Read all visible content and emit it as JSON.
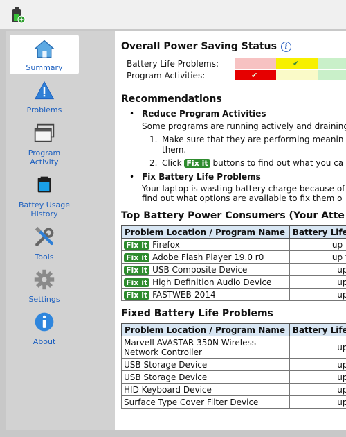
{
  "app": {
    "icon": "battery-power-icon"
  },
  "sidebar": {
    "items": [
      {
        "label": "Summary",
        "icon": "house-icon",
        "active": true
      },
      {
        "label": "Problems",
        "icon": "warning-icon"
      },
      {
        "label": "Program Activity",
        "icon": "windows-icon"
      },
      {
        "label": "Battey Usage History",
        "icon": "battery-icon"
      },
      {
        "label": "Tools",
        "icon": "tools-icon"
      },
      {
        "label": "Settings",
        "icon": "gear-icon"
      },
      {
        "label": "About",
        "icon": "info-icon"
      }
    ]
  },
  "status": {
    "title": "Overall Power Saving Status",
    "rows": [
      {
        "label": "Battery Life Problems:",
        "colors": [
          "#f7c2c2",
          "#f7f000",
          "#c9f0c9"
        ],
        "check_index": 1
      },
      {
        "label": "Program Activities:",
        "colors": [
          "#e60000",
          "#fafac8",
          "#c9f0c9"
        ],
        "check_index": 0
      }
    ]
  },
  "recommendations": {
    "title": "Recommendations",
    "items": [
      {
        "heading": "Reduce Program Activities",
        "text": "Some programs are running actively and draining",
        "steps": [
          {
            "num": "1.",
            "line1": "Make sure that they are performing meanin",
            "line2": "them."
          },
          {
            "num": "2.",
            "before": "Click",
            "button": "Fix it",
            "after": "buttons to find out what you ca"
          }
        ]
      },
      {
        "heading": "Fix Battery Life Problems",
        "line1": "Your laptop is wasting battery charge because of",
        "line2": "find out what options are available to fix them o"
      }
    ]
  },
  "top_consumers": {
    "title": "Top Battery Power Consumers (Your Atte",
    "headers": [
      "Problem Location / Program Name",
      "Battery Life"
    ],
    "fix_label": "Fix it",
    "rows": [
      {
        "name": "Firefox",
        "value": "up to"
      },
      {
        "name": "Adobe Flash Player 19.0 r0",
        "value": "up to"
      },
      {
        "name": "USB Composite Device",
        "value": "up t"
      },
      {
        "name": "High Definition Audio Device",
        "value": "up t"
      },
      {
        "name": "FASTWEB-2014",
        "value": "up t"
      }
    ]
  },
  "fixed_problems": {
    "title": "Fixed Battery Life Problems",
    "headers": [
      "Problem Location / Program Name",
      "Battery Life"
    ],
    "rows": [
      {
        "name": "Marvell AVASTAR 350N Wireless",
        "name2": "Network Controller",
        "value": "up t"
      },
      {
        "name": "USB Storage Device",
        "value": "up t"
      },
      {
        "name": "USB Storage Device",
        "value": "up t"
      },
      {
        "name": "HID Keyboard Device",
        "value": "up t"
      },
      {
        "name": "Surface Type Cover Filter Device",
        "value": "up t"
      }
    ]
  }
}
